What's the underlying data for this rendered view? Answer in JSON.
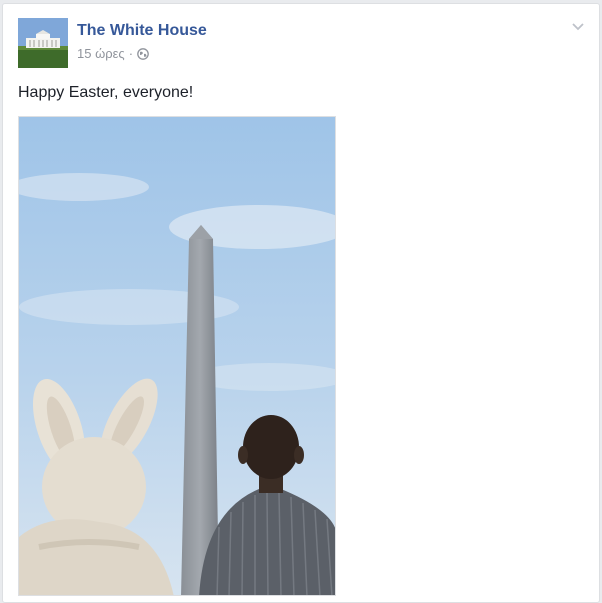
{
  "post": {
    "author": "The White House",
    "time": "15 ώρες",
    "separator": "·",
    "privacy_icon": "globe-icon",
    "menu_icon": "chevron-down-icon",
    "text": "Happy Easter, everyone!"
  },
  "colors": {
    "link": "#365899",
    "meta": "#90949c",
    "text": "#1d2129"
  }
}
